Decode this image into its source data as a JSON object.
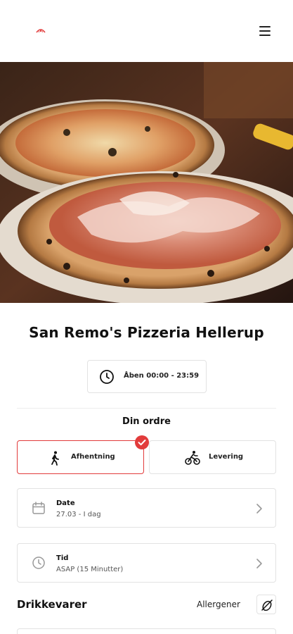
{
  "header": {
    "logo_icon": "pizzeria-logo-icon",
    "menu_icon": "hamburger-menu-icon"
  },
  "hero": {
    "image": "pizza-photo"
  },
  "restaurant": {
    "name": "San Remo's Pizzeria Hellerup",
    "hours_icon": "clock-icon",
    "hours": "Åben 00:00 - 23:59"
  },
  "order": {
    "title": "Din ordre",
    "options": [
      {
        "label": "Afhentning",
        "icon": "walking-person-icon",
        "selected": true
      },
      {
        "label": "Levering",
        "icon": "cyclist-icon",
        "selected": false
      }
    ],
    "date": {
      "label": "Date",
      "value": "27.03 - I dag",
      "icon": "calendar-icon"
    },
    "time": {
      "label": "Tid",
      "value": "ASAP (15 Minutter)",
      "icon": "clock-icon"
    }
  },
  "menu_section": {
    "title": "Drikkevarer",
    "allergen_label": "Allergener",
    "allergen_icon": "allergen-icon"
  },
  "colors": {
    "accent": "#e23b3b",
    "border": "#e2e2e2",
    "text": "#111111"
  }
}
